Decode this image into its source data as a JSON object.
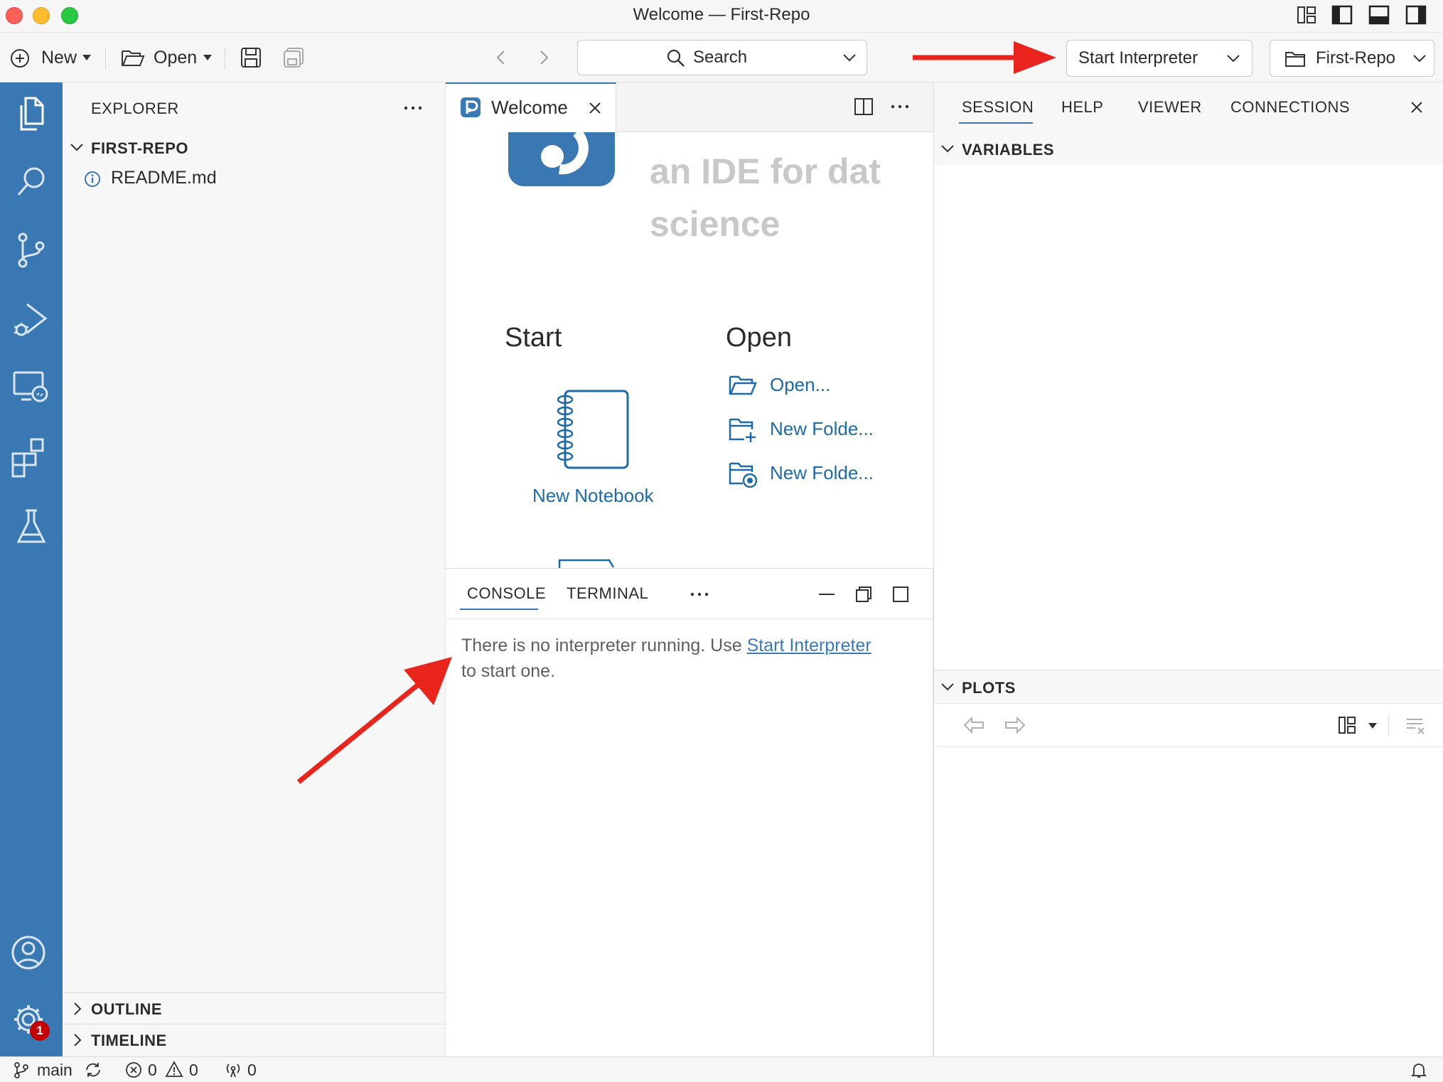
{
  "window": {
    "title": "Welcome — First-Repo"
  },
  "toolbar": {
    "new_label": "New",
    "open_label": "Open",
    "search_label": "Search",
    "interpreter_label": "Start Interpreter",
    "folder_label": "First-Repo"
  },
  "explorer": {
    "header": "EXPLORER",
    "root": "FIRST-REPO",
    "files": [
      "README.md"
    ],
    "outline": "OUTLINE",
    "timeline": "TIMELINE"
  },
  "editor": {
    "tab_label": "Welcome",
    "headline_line1": "an IDE for dat",
    "headline_line2": "science",
    "start_heading": "Start",
    "new_notebook": "New Notebook",
    "open_heading": "Open",
    "open_items": [
      "Open...",
      "New Folde...",
      "New Folde..."
    ]
  },
  "console": {
    "tabs": [
      "CONSOLE",
      "TERMINAL"
    ],
    "message_before": "There is no interpreter running. Use ",
    "message_link": "Start Interpreter",
    "message_after": "to start one."
  },
  "right_panel": {
    "tabs": [
      "SESSION",
      "HELP",
      "VIEWER",
      "CONNECTIONS"
    ],
    "variables": "VARIABLES",
    "plots": "PLOTS"
  },
  "status": {
    "branch": "main",
    "errors": "0",
    "warnings": "0",
    "ports": "0"
  },
  "badges": {
    "settings_count": "1"
  },
  "colors": {
    "accent": "#3a78b4",
    "arrow": "#e8241c",
    "link": "#1e6aa6"
  }
}
